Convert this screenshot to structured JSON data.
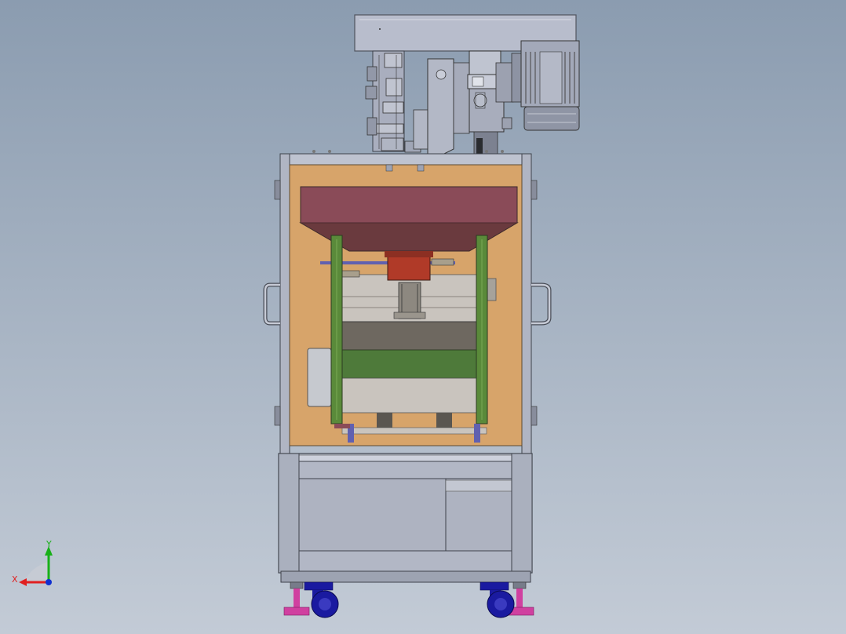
{
  "viewport": {
    "background_top": "#8b9cb0",
    "background_bottom": "#c3cbd6"
  },
  "triad": {
    "x_label": "X",
    "y_label": "Y",
    "x_color": "#e02020",
    "y_color": "#18b018",
    "z_color": "#1030d0"
  },
  "colors": {
    "frame": "#b4b9c9",
    "frame_dark": "#6c7180",
    "enclosure_inner": "#d7a46a",
    "hopper_top": "#8a4b58",
    "hopper_funnel": "#6a3a3e",
    "green_rail": "#5a8a3a",
    "gray_cylinder": "#c9c4be",
    "dark_band": "#6e6860",
    "green_band": "#4e7a3a",
    "red_block": "#b03a28",
    "motor": "#9ea4b6",
    "caster_blue": "#1a1aa0",
    "foot_magenta": "#d040a0",
    "purple_rod": "#6060b0"
  }
}
